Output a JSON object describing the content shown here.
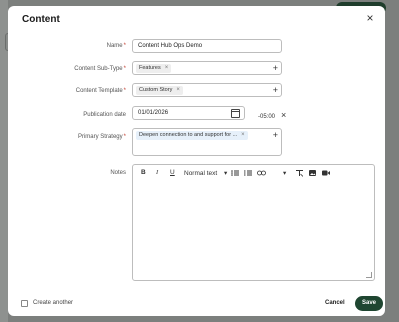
{
  "background": {
    "back_icon": "chevron-left-icon"
  },
  "modal": {
    "title": "Content",
    "close_icon": "×"
  },
  "form": {
    "name": {
      "label": "Name",
      "required": "*",
      "value": "Content Hub Ops Demo"
    },
    "content_subtype": {
      "label": "Content Sub-Type",
      "required": "*",
      "chips": [
        "Features"
      ],
      "chip_remove": "×",
      "add": "+"
    },
    "content_template": {
      "label": "Content Template",
      "required": "*",
      "chips": [
        "Custom Story"
      ],
      "chip_remove": "×",
      "add": "+"
    },
    "publication_date": {
      "label": "Publication date",
      "value": "01/01/2026",
      "timezone": "-05:00",
      "clear": "×"
    },
    "primary_strategy": {
      "label": "Primary Strategy",
      "required": "*",
      "chips": [
        "Deepen connection to and support for ..."
      ],
      "chip_remove": "×",
      "add": "+"
    },
    "notes": {
      "label": "Notes",
      "toolbar": {
        "bold": "B",
        "italic": "I",
        "underline": "U",
        "text_style": "Normal text",
        "text_style_caret": "▾",
        "more_caret": "▾"
      },
      "value": ""
    }
  },
  "footer": {
    "create_another": "Create another",
    "cancel": "Cancel",
    "save": "Save"
  },
  "colors": {
    "primary": "#1f4631",
    "required": "#c0392b",
    "chip_subtype": "#e9e9e9",
    "chip_template": "#e9e9e9",
    "chip_strategy": "#e6f0fa"
  }
}
